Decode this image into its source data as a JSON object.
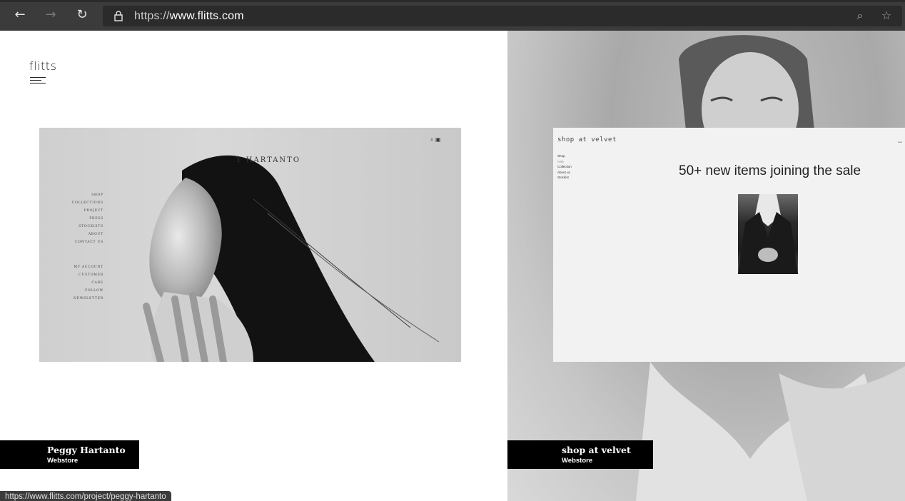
{
  "browser": {
    "url_scheme": "https://",
    "url_host": "www.flitts.com",
    "status_url": "https://www.flitts.com/project/peggy-hartanto"
  },
  "site": {
    "logo_text": "flitts"
  },
  "projects": {
    "left": {
      "preview": {
        "site_title": "Y HARTANTO",
        "menu_primary": [
          "SHOP",
          "COLLECTIONS",
          "PROJECT",
          "PRESS",
          "STOCKISTS",
          "ABOUT",
          "CONTACT US"
        ],
        "menu_secondary": [
          "MY ACCOUNT",
          "CUSTOMER CARE",
          "FOLLOW",
          "NEWSLETTER"
        ]
      },
      "label_title": "Peggy Hartanto",
      "label_subtitle": "Webstore"
    },
    "right": {
      "preview": {
        "brand": "shop  at  velvet",
        "menu": [
          "Shop",
          "Sale",
          "Collection",
          "About us",
          "Stockist"
        ],
        "headline": "50+ new items joining the sale",
        "corner_text": "Sear"
      },
      "label_title": "shop at velvet",
      "label_subtitle": "Webstore"
    }
  }
}
